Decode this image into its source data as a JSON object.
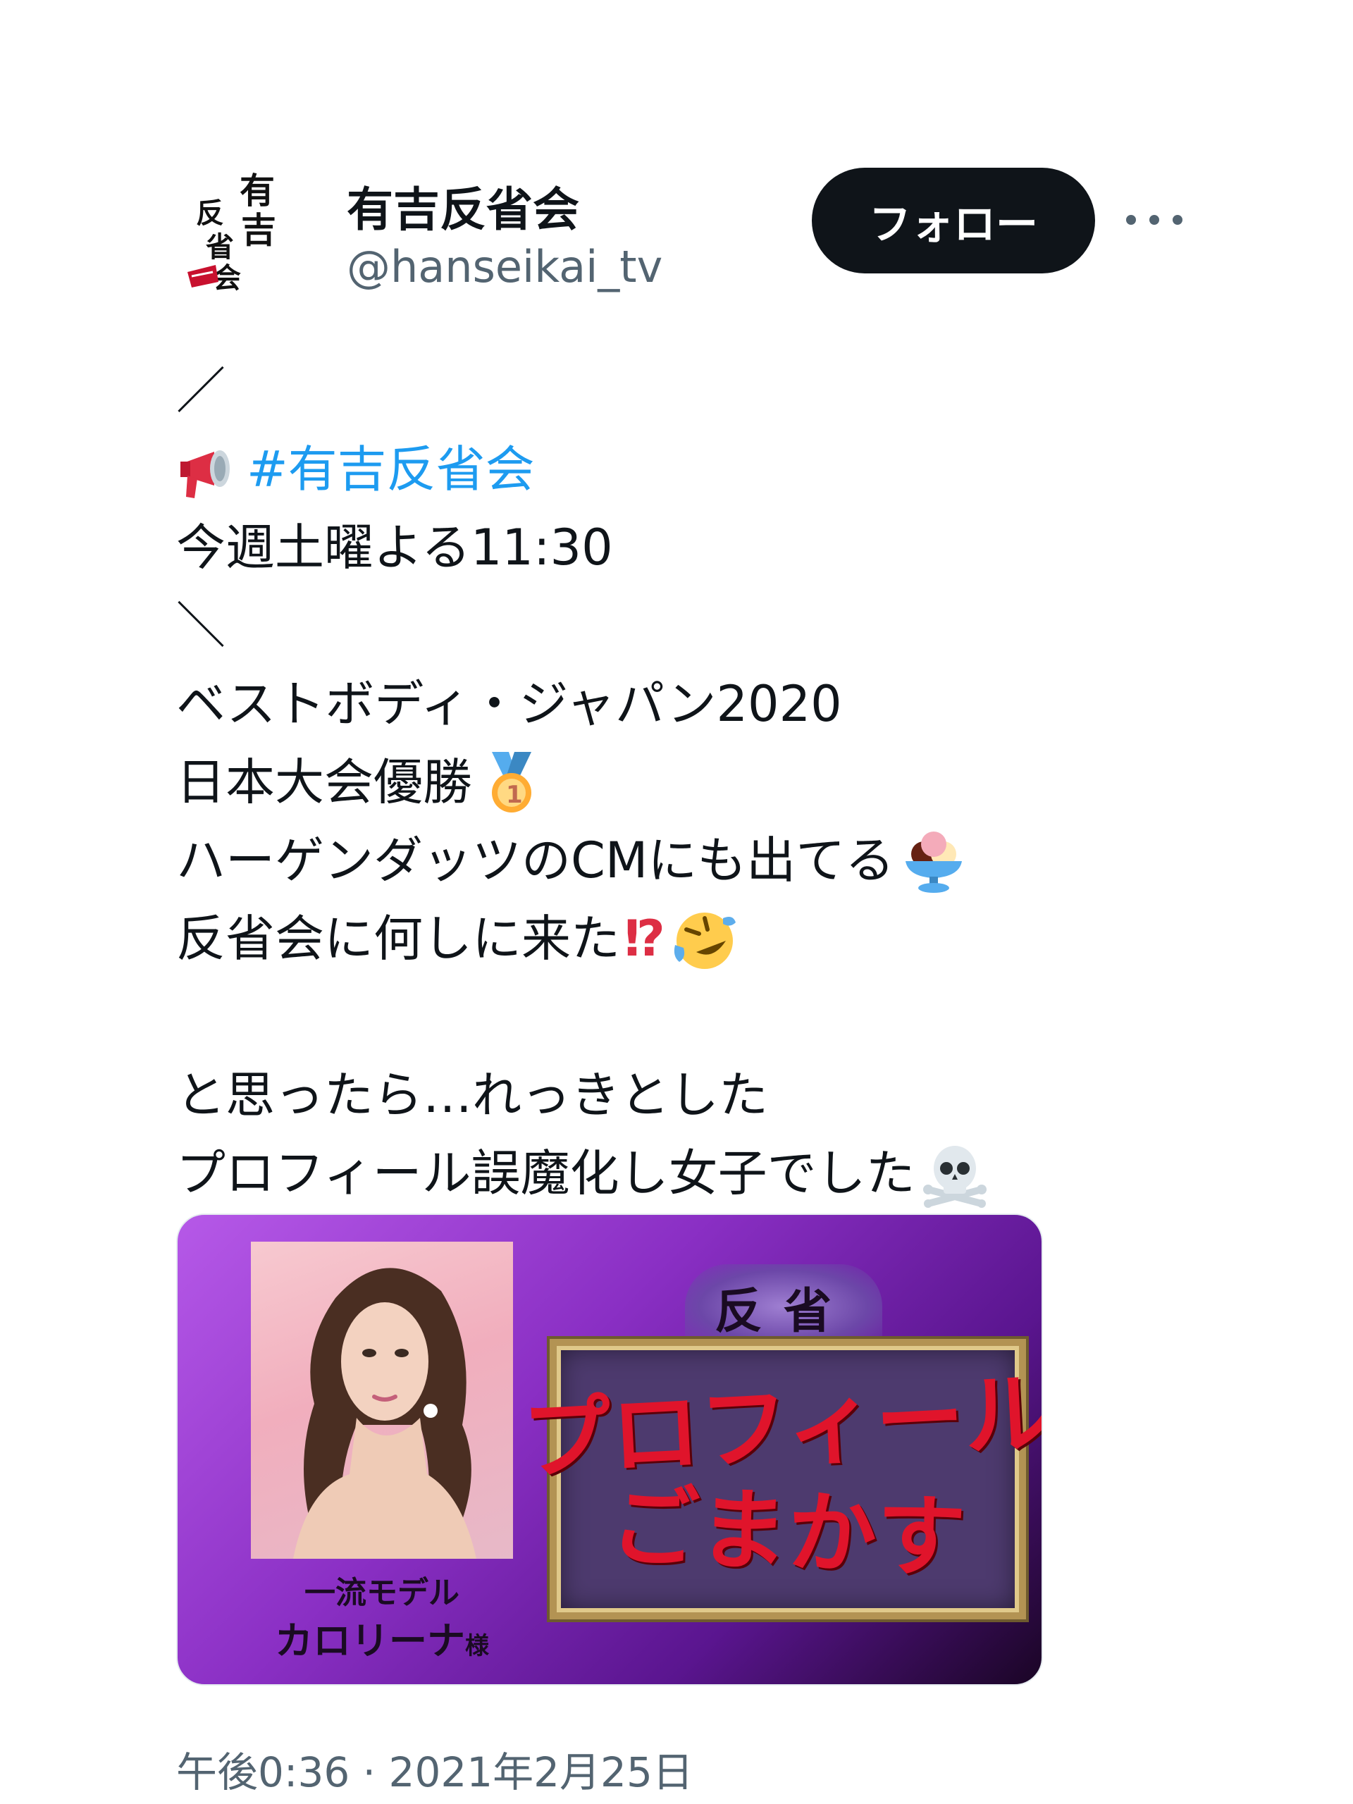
{
  "author": {
    "avatar_text": "有吉反省会",
    "display_name": "有吉反省会",
    "handle": "@hanseikai_tv"
  },
  "header": {
    "follow_label": "フォロー"
  },
  "tweet": {
    "lines": {
      "l1": "／",
      "l2_hashtag": "#有吉反省会",
      "l3": "今週土曜よる11:30",
      "l4": "＼",
      "l5": "ベストボディ・ジャパン2020",
      "l6": "日本大会優勝",
      "l7": "ハーゲンダッツのCMにも出てる",
      "l8": "反省会に何しに来た",
      "l8_punct": "⁉",
      "l9": "",
      "l10": "と思ったら…れっきとした",
      "l11": "プロフィール誤魔化し女子でした"
    },
    "emojis": [
      "megaphone-icon",
      "gold-medal-icon",
      "ice-cream-icon",
      "rolling-laughing-icon",
      "skull-crossbones-icon"
    ],
    "timestamp": "午後0:36 · 2021年2月25日"
  },
  "media": {
    "caption_small": "一流モデル",
    "caption_name": "カロリーナ",
    "caption_suffix": "様",
    "mask_label": "反省",
    "board_line1": "プロフィール",
    "board_line2": "ごまかす"
  },
  "colors": {
    "hashtag": "#1d9bf0",
    "follow_bg": "#0f1419",
    "secondary_text": "#536471",
    "board_text": "#e0142b"
  }
}
